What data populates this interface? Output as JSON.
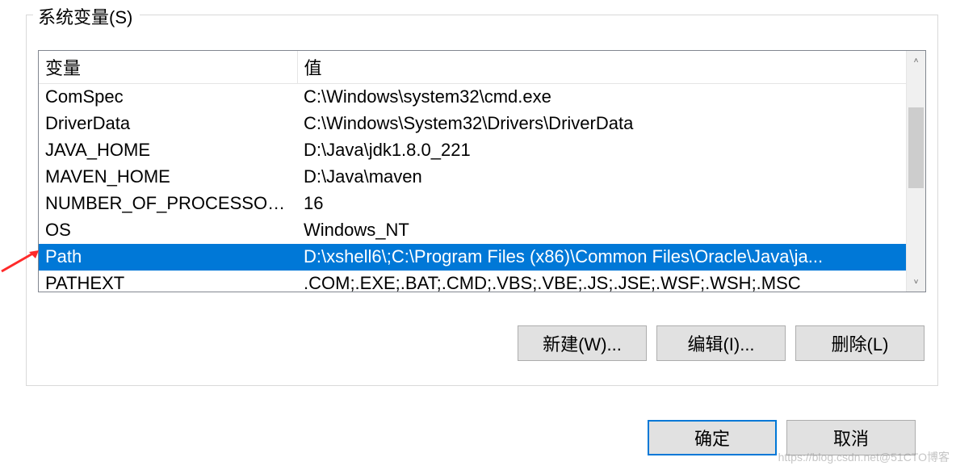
{
  "group": {
    "label": "系统变量(S)"
  },
  "table": {
    "headers": {
      "variable": "变量",
      "value": "值"
    },
    "rows": [
      {
        "variable": "ComSpec",
        "value": "C:\\Windows\\system32\\cmd.exe",
        "selected": false
      },
      {
        "variable": "DriverData",
        "value": "C:\\Windows\\System32\\Drivers\\DriverData",
        "selected": false
      },
      {
        "variable": "JAVA_HOME",
        "value": "D:\\Java\\jdk1.8.0_221",
        "selected": false
      },
      {
        "variable": "MAVEN_HOME",
        "value": "D:\\Java\\maven",
        "selected": false
      },
      {
        "variable": "NUMBER_OF_PROCESSORS",
        "value": "16",
        "selected": false
      },
      {
        "variable": "OS",
        "value": "Windows_NT",
        "selected": false
      },
      {
        "variable": "Path",
        "value": "D:\\xshell6\\;C:\\Program Files (x86)\\Common Files\\Oracle\\Java\\ja...",
        "selected": true
      },
      {
        "variable": "PATHEXT",
        "value": ".COM;.EXE;.BAT;.CMD;.VBS;.VBE;.JS;.JSE;.WSF;.WSH;.MSC",
        "selected": false
      }
    ]
  },
  "buttons": {
    "new": "新建(W)...",
    "edit": "编辑(I)...",
    "delete": "删除(L)",
    "ok": "确定",
    "cancel": "取消"
  },
  "scroll": {
    "up": "˄",
    "down": "˅"
  },
  "watermark": "https://blog.csdn.net@51CTO博客"
}
